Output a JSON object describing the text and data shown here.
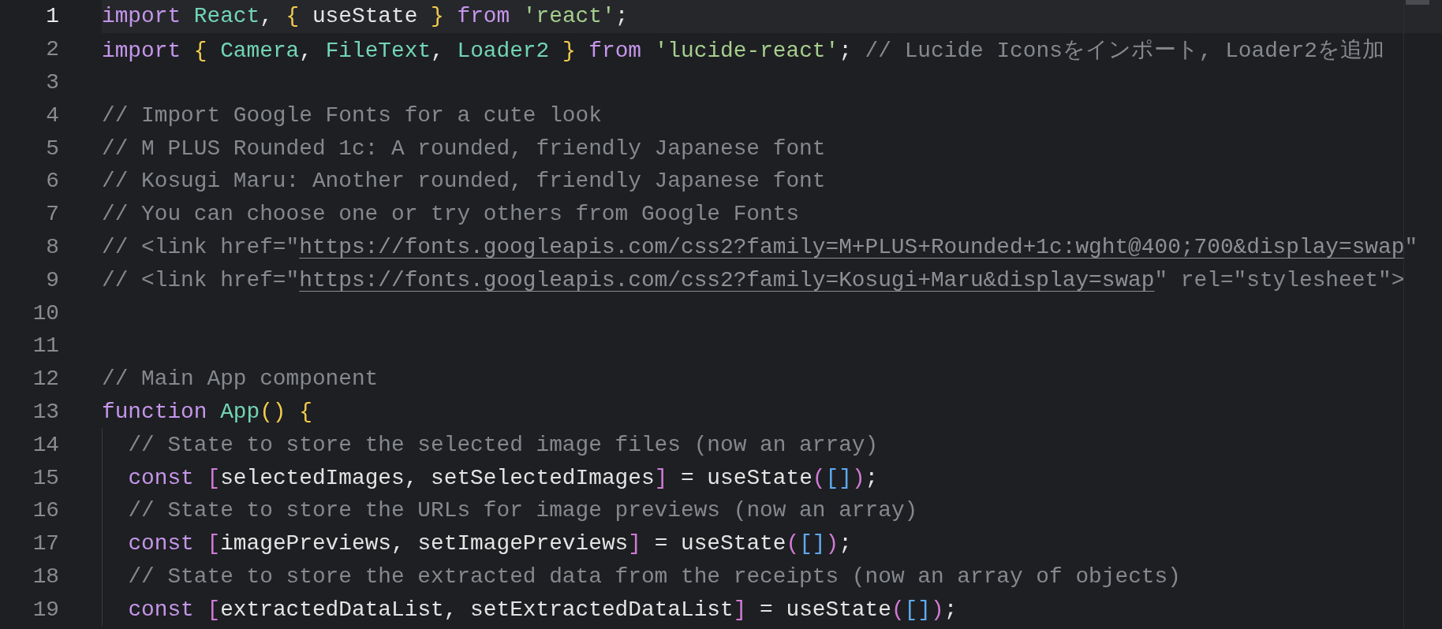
{
  "editor": {
    "lines": [
      {
        "number": "1",
        "current": true,
        "tokens": [
          {
            "kind": "keyword",
            "text": "import "
          },
          {
            "kind": "entity",
            "text": "React"
          },
          {
            "kind": "plain",
            "text": ", "
          },
          {
            "kind": "brace",
            "text": "{ "
          },
          {
            "kind": "plain",
            "text": "useState "
          },
          {
            "kind": "brace",
            "text": "} "
          },
          {
            "kind": "keyword",
            "text": "from "
          },
          {
            "kind": "string",
            "text": "'react'"
          },
          {
            "kind": "plain",
            "text": ";"
          }
        ]
      },
      {
        "number": "2",
        "current": false,
        "tokens": [
          {
            "kind": "keyword",
            "text": "import "
          },
          {
            "kind": "brace",
            "text": "{ "
          },
          {
            "kind": "entity",
            "text": "Camera"
          },
          {
            "kind": "plain",
            "text": ", "
          },
          {
            "kind": "entity",
            "text": "FileText"
          },
          {
            "kind": "plain",
            "text": ", "
          },
          {
            "kind": "entity",
            "text": "Loader2 "
          },
          {
            "kind": "brace",
            "text": "} "
          },
          {
            "kind": "keyword",
            "text": "from "
          },
          {
            "kind": "string",
            "text": "'lucide-react'"
          },
          {
            "kind": "plain",
            "text": "; "
          },
          {
            "kind": "comment",
            "text": "// Lucide Iconsをインポート, Loader2を追加"
          }
        ]
      },
      {
        "number": "3",
        "current": false
      },
      {
        "number": "4",
        "current": false,
        "tokens": [
          {
            "kind": "comment",
            "text": "// Import Google Fonts for a cute look"
          }
        ]
      },
      {
        "number": "5",
        "current": false,
        "tokens": [
          {
            "kind": "comment",
            "text": "// M PLUS Rounded 1c: A rounded, friendly Japanese font"
          }
        ]
      },
      {
        "number": "6",
        "current": false,
        "tokens": [
          {
            "kind": "comment",
            "text": "// Kosugi Maru: Another rounded, friendly Japanese font"
          }
        ]
      },
      {
        "number": "7",
        "current": false,
        "tokens": [
          {
            "kind": "comment",
            "text": "// You can choose one or try others from Google Fonts"
          }
        ]
      },
      {
        "number": "8",
        "current": false,
        "tokens": [
          {
            "kind": "comment",
            "text": "// <link href=\""
          },
          {
            "kind": "link",
            "text": "https://fonts.googleapis.com/css2?family=M+PLUS+Rounded+1c:wght@400;700&display=swap"
          },
          {
            "kind": "comment",
            "text": "\""
          }
        ]
      },
      {
        "number": "9",
        "current": false,
        "tokens": [
          {
            "kind": "comment",
            "text": "// <link href=\""
          },
          {
            "kind": "link",
            "text": "https://fonts.googleapis.com/css2?family=Kosugi+Maru&display=swap"
          },
          {
            "kind": "comment",
            "text": "\" rel=\"stylesheet\">"
          }
        ]
      },
      {
        "number": "10",
        "current": false
      },
      {
        "number": "11",
        "current": false
      },
      {
        "number": "12",
        "current": false,
        "tokens": [
          {
            "kind": "comment",
            "text": "// Main App component"
          }
        ]
      },
      {
        "number": "13",
        "current": false,
        "tokens": [
          {
            "kind": "keyword",
            "text": "function "
          },
          {
            "kind": "entity",
            "text": "App"
          },
          {
            "kind": "brace",
            "text": "() {"
          }
        ],
        "children": [
          {
            "number": "14",
            "current": false,
            "tokens": [
              {
                "kind": "comment",
                "text": "// State to store the selected image files (now an array)"
              }
            ]
          },
          {
            "number": "15",
            "current": false,
            "tokens": [
              {
                "kind": "keyword",
                "text": "const "
              },
              {
                "kind": "bracket",
                "text": "["
              },
              {
                "kind": "plain",
                "text": "selectedImages, setSelectedImages"
              },
              {
                "kind": "bracket",
                "text": "]"
              },
              {
                "kind": "plain",
                "text": " = useState"
              },
              {
                "kind": "bracket",
                "text": "("
              },
              {
                "kind": "nested",
                "text": "[]"
              },
              {
                "kind": "bracket",
                "text": ")"
              },
              {
                "kind": "plain",
                "text": ";"
              }
            ]
          },
          {
            "number": "16",
            "current": false,
            "tokens": [
              {
                "kind": "comment",
                "text": "// State to store the URLs for image previews (now an array)"
              }
            ]
          },
          {
            "number": "17",
            "current": false,
            "tokens": [
              {
                "kind": "keyword",
                "text": "const "
              },
              {
                "kind": "bracket",
                "text": "["
              },
              {
                "kind": "plain",
                "text": "imagePreviews, setImagePreviews"
              },
              {
                "kind": "bracket",
                "text": "]"
              },
              {
                "kind": "plain",
                "text": " = useState"
              },
              {
                "kind": "bracket",
                "text": "("
              },
              {
                "kind": "nested",
                "text": "[]"
              },
              {
                "kind": "bracket",
                "text": ")"
              },
              {
                "kind": "plain",
                "text": ";"
              }
            ]
          },
          {
            "number": "18",
            "current": false,
            "tokens": [
              {
                "kind": "comment",
                "text": "// State to store the extracted data from the receipts (now an array of objects)"
              }
            ]
          },
          {
            "number": "19",
            "current": false,
            "tokens": [
              {
                "kind": "keyword",
                "text": "const "
              },
              {
                "kind": "bracket",
                "text": "["
              },
              {
                "kind": "plain",
                "text": "extractedDataList, setExtractedDataList"
              },
              {
                "kind": "bracket",
                "text": "]"
              },
              {
                "kind": "plain",
                "text": " = useState"
              },
              {
                "kind": "bracket",
                "text": "("
              },
              {
                "kind": "nested",
                "text": "[]"
              },
              {
                "kind": "bracket",
                "text": ")"
              },
              {
                "kind": "plain",
                "text": ";"
              }
            ]
          }
        ]
      }
    ]
  }
}
